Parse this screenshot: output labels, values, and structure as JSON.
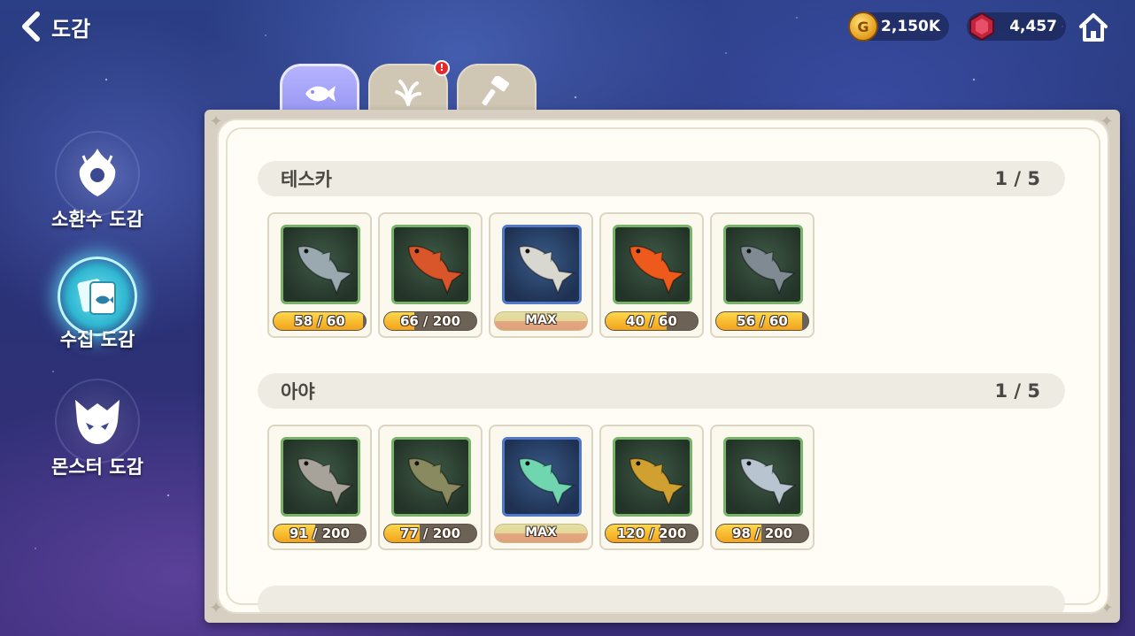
{
  "header": {
    "title": "도감",
    "gold": "2,150K",
    "gems": "4,457"
  },
  "nav": [
    {
      "label": "소환수 도감",
      "icon": "summon-crest-icon",
      "active": false
    },
    {
      "label": "수집 도감",
      "icon": "collection-cards-icon",
      "active": true
    },
    {
      "label": "몬스터 도감",
      "icon": "monster-mask-icon",
      "active": false
    }
  ],
  "tabs": [
    {
      "icon": "fish-icon",
      "active": true,
      "alert": false
    },
    {
      "icon": "plant-icon",
      "active": false,
      "alert": true,
      "alert_glyph": "!"
    },
    {
      "icon": "hammer-icon",
      "active": false,
      "alert": false
    }
  ],
  "sections": [
    {
      "name": "테스카",
      "count": "1 / 5",
      "items": [
        {
          "label": "58 / 60",
          "progress": 0.967,
          "max": false,
          "fish": "needlefish",
          "color": "#9aa9b0"
        },
        {
          "label": "66 / 200",
          "progress": 0.33,
          "max": false,
          "fish": "grouper",
          "color": "#d9552a"
        },
        {
          "label": "MAX",
          "progress": 1,
          "max": true,
          "fish": "spotted-flounder",
          "color": "#d8d8d0"
        },
        {
          "label": "40 / 60",
          "progress": 0.667,
          "max": false,
          "fish": "clownfish",
          "color": "#ee5a1c"
        },
        {
          "label": "56 / 60",
          "progress": 0.933,
          "max": false,
          "fish": "catfish",
          "color": "#7f8a92"
        }
      ]
    },
    {
      "name": "아야",
      "count": "1 / 5",
      "items": [
        {
          "label": "91 / 200",
          "progress": 0.455,
          "max": false,
          "fish": "trout",
          "color": "#a8a39a"
        },
        {
          "label": "77 / 200",
          "progress": 0.385,
          "max": false,
          "fish": "bass",
          "color": "#8a8a60"
        },
        {
          "label": "MAX",
          "progress": 1,
          "max": true,
          "fish": "herring",
          "color": "#6fd6b0"
        },
        {
          "label": "120 / 200",
          "progress": 0.6,
          "max": false,
          "fish": "perch",
          "color": "#d0a030"
        },
        {
          "label": "98 / 200",
          "progress": 0.49,
          "max": false,
          "fish": "mackerel",
          "color": "#b8c4d0"
        }
      ]
    }
  ]
}
